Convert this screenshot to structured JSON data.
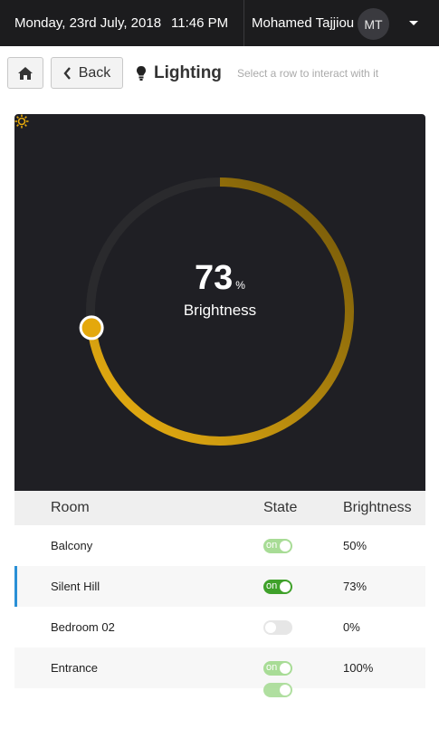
{
  "header": {
    "date": "Monday, 23rd July, 2018",
    "time": "11:46 PM",
    "user_name": "Mohamed Tajjiou",
    "avatar_initials": "MT"
  },
  "toolbar": {
    "back_label": "Back",
    "title": "Lighting",
    "hint": "Select a row to interact with it"
  },
  "dial": {
    "value": "73",
    "value_fraction": 0.73,
    "unit": "%",
    "label": "Brightness",
    "colors": {
      "arc_start": "#f0b412",
      "arc_end": "#6e5408",
      "track": "#2a2a2d",
      "background": "#1f1f24"
    }
  },
  "table": {
    "columns": {
      "room": "Room",
      "state": "State",
      "brightness": "Brightness"
    },
    "rows": [
      {
        "room": "Balcony",
        "state_label": "on",
        "brightness": "50%"
      },
      {
        "room": "Silent Hill",
        "state_label": "on",
        "brightness": "73%"
      },
      {
        "room": "Bedroom 02",
        "state_label": "",
        "brightness": "0%"
      },
      {
        "room": "Entrance",
        "state_label": "on",
        "brightness": "100%"
      }
    ]
  }
}
